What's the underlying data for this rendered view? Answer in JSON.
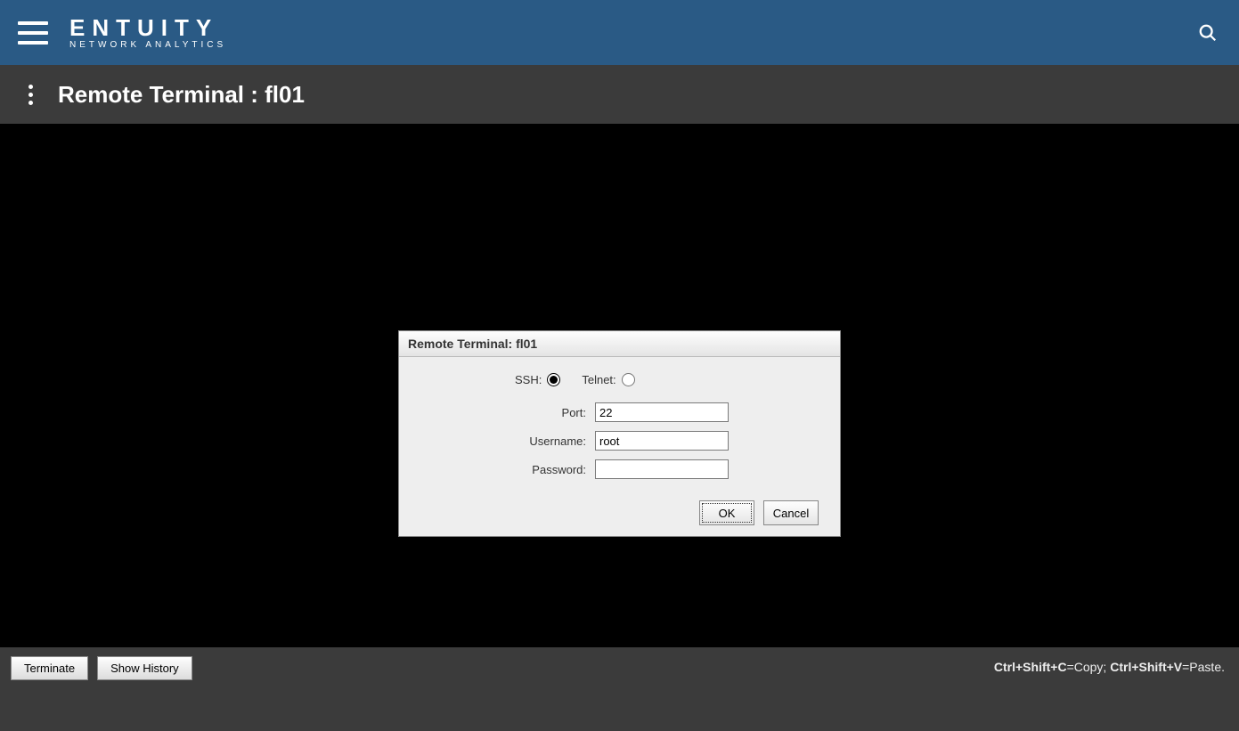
{
  "header": {
    "brand_main": "ENTUITY",
    "brand_sub": "NETWORK ANALYTICS"
  },
  "subheader": {
    "title": "Remote Terminal : fl01"
  },
  "dialog": {
    "title": "Remote Terminal: fl01",
    "ssh_label": "SSH:",
    "telnet_label": "Telnet:",
    "port_label": "Port:",
    "port_value": "22",
    "username_label": "Username:",
    "username_value": "root",
    "password_label": "Password:",
    "password_value": "",
    "ok_label": "OK",
    "cancel_label": "Cancel",
    "selected_proto": "ssh"
  },
  "bottombar": {
    "terminate_label": "Terminate",
    "show_history_label": "Show History",
    "hint_copy_key": "Ctrl+Shift+C",
    "hint_copy_text": "=Copy; ",
    "hint_paste_key": "Ctrl+Shift+V",
    "hint_paste_text": "=Paste."
  }
}
